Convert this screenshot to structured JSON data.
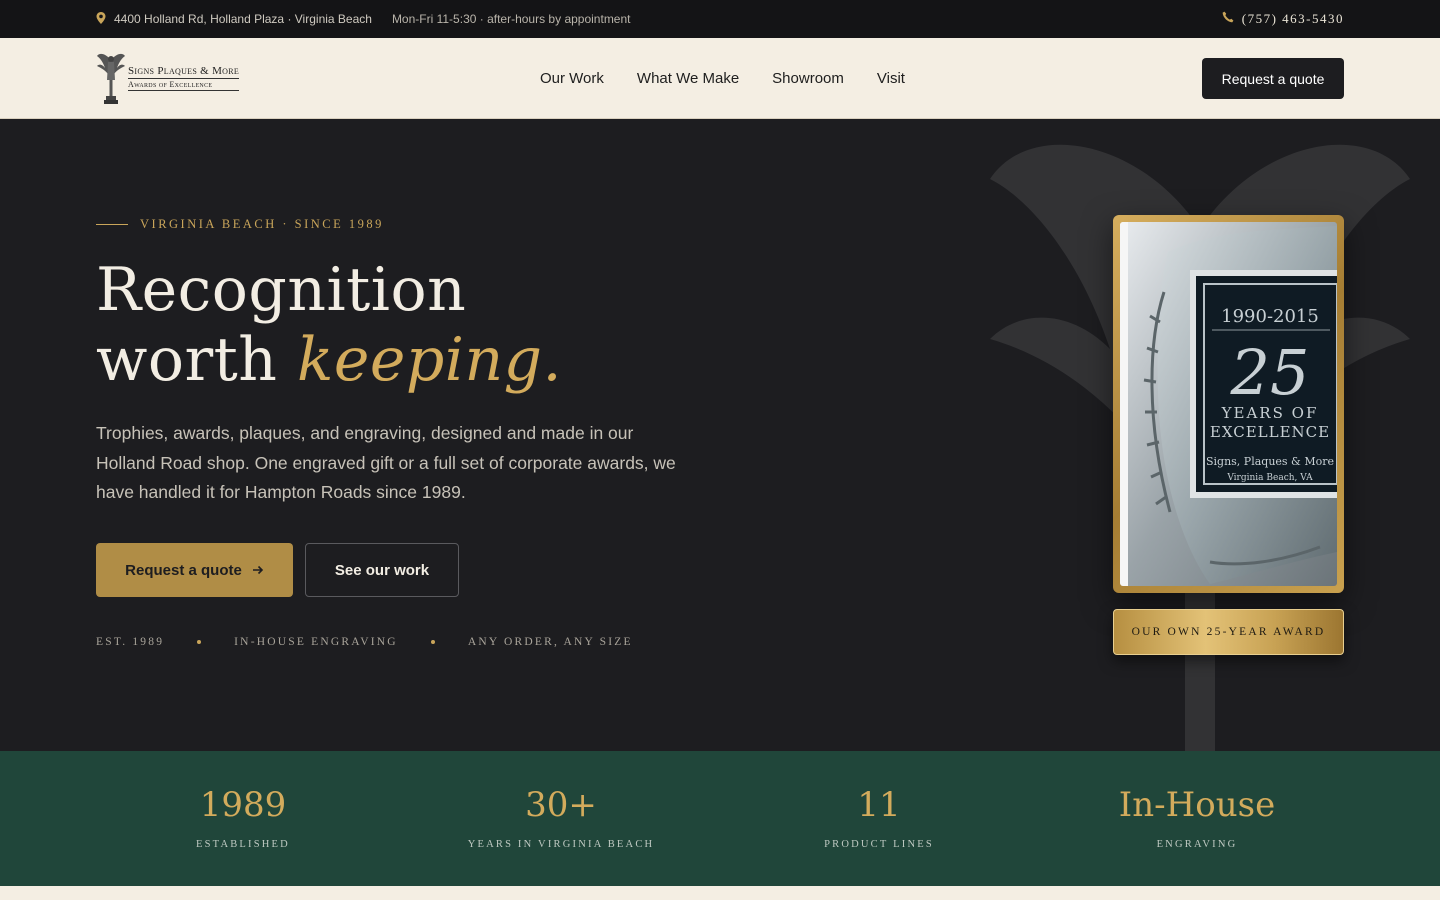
{
  "topbar": {
    "address": "4400 Holland Rd, Holland Plaza · Virginia Beach",
    "hours": "Mon-Fri 11-5:30 · after-hours by appointment",
    "phone": "(757) 463-5430",
    "icons": [
      "map-pin-icon",
      "phone-icon"
    ]
  },
  "header": {
    "logo_line1": "Signs Plaques & More",
    "logo_line2": "Awards of Excellence",
    "nav": [
      "Our Work",
      "What We Make",
      "Showroom",
      "Visit"
    ],
    "cta": "Request a quote"
  },
  "hero": {
    "eyebrow": "VIRGINIA BEACH · SINCE 1989",
    "headline_line1": "Recognition",
    "headline_line2_plain": "worth ",
    "headline_line2_accent": "keeping.",
    "lede": "Trophies, awards, plaques, and engraving, designed and made in our Holland Road shop. One engraved gift or a full set of corporate awards, we have handled it for Hampton Roads since 1989.",
    "primary_button": "Request a quote",
    "primary_button_icon": "arrow-right-icon",
    "secondary_button": "See our work",
    "tags": [
      "EST. 1989",
      "IN-HOUSE ENGRAVING",
      "ANY ORDER, ANY SIZE"
    ],
    "award_caption": "OUR OWN 25-YEAR AWARD",
    "award": {
      "years": "1990-2015",
      "number": "25",
      "line1": "YEARS OF",
      "line2": "EXCELLENCE",
      "maker": "Signs, Plaques & More",
      "location": "Virginia Beach, VA"
    }
  },
  "stats": [
    {
      "value": "1989",
      "label": "ESTABLISHED"
    },
    {
      "value": "30+",
      "label": "YEARS IN VIRGINIA BEACH"
    },
    {
      "value": "11",
      "label": "PRODUCT LINES"
    },
    {
      "value": "In-House",
      "label": "ENGRAVING"
    }
  ],
  "colors": {
    "gold": "#d3ab5c",
    "dark": "#1d1d20",
    "cream": "#f4eee3",
    "green": "#20463a"
  }
}
